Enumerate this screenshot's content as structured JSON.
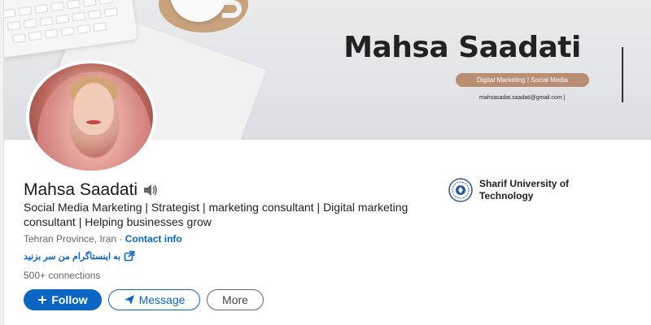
{
  "banner": {
    "name": "Mahsa Saadati",
    "tagline": "Digital Marketing | Social Media",
    "email": "mahsasadat.saadati@gmail.com |"
  },
  "profile": {
    "name": "Mahsa Saadati",
    "headline": "Social Media Marketing | Strategist | marketing consultant | Digital marketing consultant | Helping businesses grow",
    "location": "Tehran Province, Iran",
    "location_separator": " · ",
    "contact_label": "Contact info",
    "external_link": "به اینستاگرام من سر بزنید",
    "connections": "500+ connections"
  },
  "education": {
    "name": "Sharif University of Technology"
  },
  "actions": {
    "follow_label": "Follow",
    "message_label": "Message",
    "more_label": "More"
  },
  "colors": {
    "primary": "#0a66c2",
    "banner_pill": "#b98e73"
  },
  "icons": {
    "follow": "plus-icon",
    "message": "send-icon",
    "pronunciation": "speaker-icon",
    "external_link": "external-link-icon",
    "school": "university-seal-icon"
  }
}
